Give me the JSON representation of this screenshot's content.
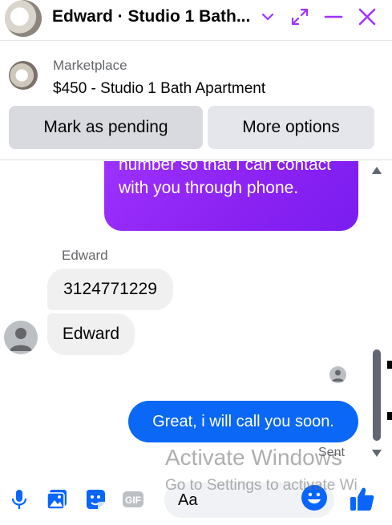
{
  "header": {
    "title": "Edward · Studio 1 Bath...",
    "icons": [
      "chevron-down-icon",
      "expand-icon",
      "minimize-icon",
      "close-icon"
    ],
    "accent_color": "#a033ff"
  },
  "listing": {
    "category": "Marketplace",
    "name": "$450 - Studio 1 Bath Apartment",
    "buttons": {
      "pending": "Mark as pending",
      "more": "More options"
    }
  },
  "thread": {
    "outgoing_partial": "number so that I can contact with you through phone.",
    "sender_name": "Edward",
    "incoming": [
      "3124771229",
      "Edward"
    ],
    "outgoing_last": "Great, i will call you soon.",
    "status": "Sent",
    "colors": {
      "purple_bubble": "#8a22f2",
      "blue_bubble": "#0b67f5",
      "incoming_bubble": "#f0f0f0"
    }
  },
  "composer": {
    "placeholder": "Aa",
    "icons": [
      "microphone-icon",
      "photo-icon",
      "sticker-icon",
      "gif-icon",
      "emoji-icon",
      "like-icon"
    ]
  },
  "overlay": {
    "line1": "Activate Windows",
    "line2": "Go to Settings to activate Wi"
  }
}
